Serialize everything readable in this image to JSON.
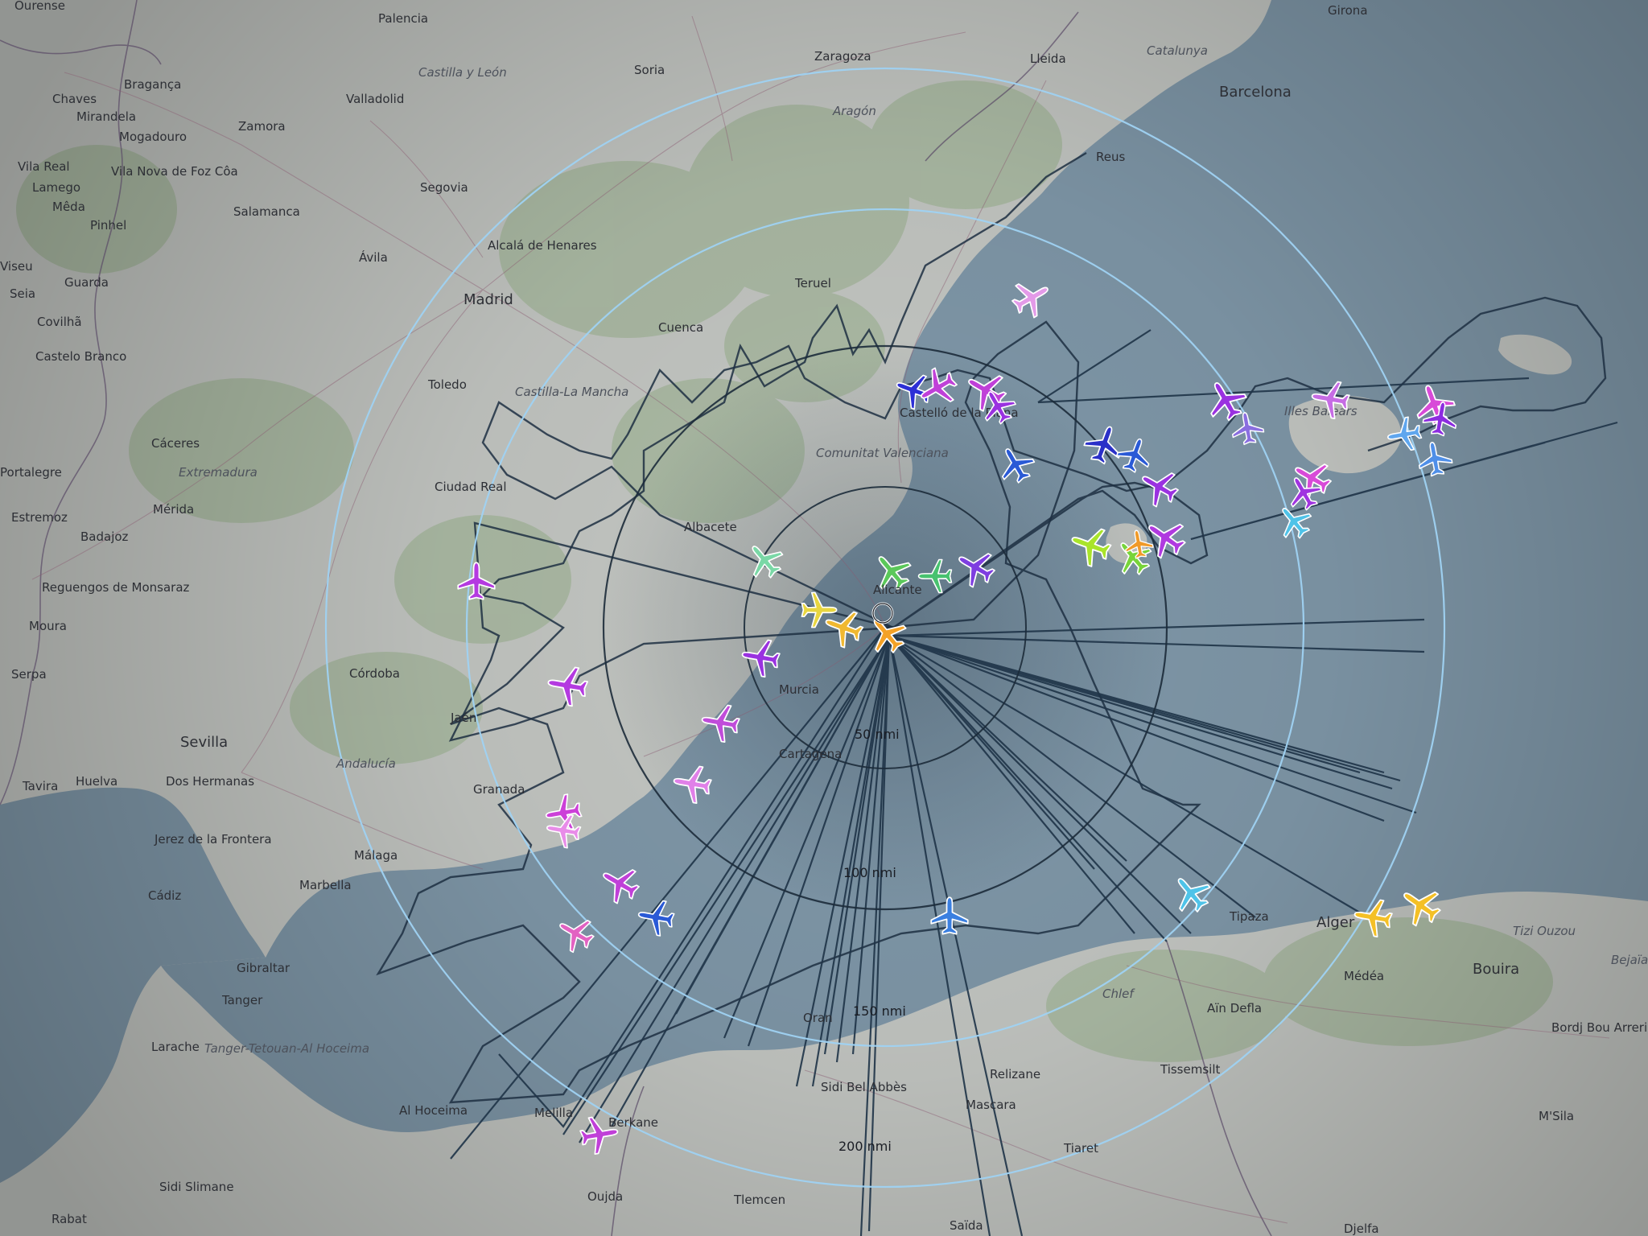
{
  "map": {
    "center_label": "Alicante",
    "range_labels": [
      "50 nmi",
      "100 nmi",
      "150 nmi",
      "200 nmi"
    ],
    "cities": [
      {
        "name": "Ourense"
      },
      {
        "name": "Palencia"
      },
      {
        "name": "Zaragoza"
      },
      {
        "name": "Lleida"
      },
      {
        "name": "Girona"
      },
      {
        "name": "Catalunya"
      },
      {
        "name": "Barcelona"
      },
      {
        "name": "Chaves"
      },
      {
        "name": "Bragança"
      },
      {
        "name": "Mirandela"
      },
      {
        "name": "Mogadouro"
      },
      {
        "name": "Vila Real"
      },
      {
        "name": "Lamego"
      },
      {
        "name": "Vila Nova de Foz Côa"
      },
      {
        "name": "Mêda"
      },
      {
        "name": "Pinhel"
      },
      {
        "name": "Viseu"
      },
      {
        "name": "Guarda"
      },
      {
        "name": "Seia"
      },
      {
        "name": "Covilhã"
      },
      {
        "name": "Castelo Branco"
      },
      {
        "name": "Zamora"
      },
      {
        "name": "Salamanca"
      },
      {
        "name": "Valladolid"
      },
      {
        "name": "Castilla y León"
      },
      {
        "name": "Soria"
      },
      {
        "name": "Aragón"
      },
      {
        "name": "Segovia"
      },
      {
        "name": "Ávila"
      },
      {
        "name": "Alcalá de Henares"
      },
      {
        "name": "Madrid"
      },
      {
        "name": "Teruel"
      },
      {
        "name": "Reus"
      },
      {
        "name": "Cuenca"
      },
      {
        "name": "Toledo"
      },
      {
        "name": "Castilla-La Mancha"
      },
      {
        "name": "Cáceres"
      },
      {
        "name": "Extremadura"
      },
      {
        "name": "Portalegre"
      },
      {
        "name": "Ciudad Real"
      },
      {
        "name": "Mérida"
      },
      {
        "name": "Estremoz"
      },
      {
        "name": "Badajoz"
      },
      {
        "name": "Reguengos de Monsaraz"
      },
      {
        "name": "Moura"
      },
      {
        "name": "Serpa"
      },
      {
        "name": "Córdoba"
      },
      {
        "name": "Jaén"
      },
      {
        "name": "Sevilla"
      },
      {
        "name": "Dos Hermanas"
      },
      {
        "name": "Andalucía"
      },
      {
        "name": "Huelva"
      },
      {
        "name": "Tavira"
      },
      {
        "name": "Granada"
      },
      {
        "name": "Jerez de la Frontera"
      },
      {
        "name": "Málaga"
      },
      {
        "name": "Marbella"
      },
      {
        "name": "Cádiz"
      },
      {
        "name": "Gibraltar"
      },
      {
        "name": "Tanger"
      },
      {
        "name": "Tanger-Tetouan-Al Hoceima"
      },
      {
        "name": "Larache"
      },
      {
        "name": "Al Hoceima"
      },
      {
        "name": "Melilla"
      },
      {
        "name": "Berkane"
      },
      {
        "name": "Oujda"
      },
      {
        "name": "Rabat"
      },
      {
        "name": "Sidi Slimane"
      },
      {
        "name": "Albacete"
      },
      {
        "name": "Comunitat Valenciana"
      },
      {
        "name": "Castelló de la Plana"
      },
      {
        "name": "Murcia"
      },
      {
        "name": "Cartagena"
      },
      {
        "name": "Oran"
      },
      {
        "name": "Sidi Bel Abbès"
      },
      {
        "name": "Mascara"
      },
      {
        "name": "Relizane"
      },
      {
        "name": "Chlef"
      },
      {
        "name": "Aïn Defla"
      },
      {
        "name": "Tissemsilt"
      },
      {
        "name": "Tiaret"
      },
      {
        "name": "Tipaza"
      },
      {
        "name": "Alger"
      },
      {
        "name": "Médéa"
      },
      {
        "name": "Bouira"
      },
      {
        "name": "Tizi Ouzou"
      },
      {
        "name": "Bordj Bou Arreridj"
      },
      {
        "name": "M'Sila"
      },
      {
        "name": "Djelfa"
      },
      {
        "name": "Tlemcen"
      },
      {
        "name": "Saïda"
      },
      {
        "name": "Illes Balears"
      },
      {
        "name": "Bejaïa"
      }
    ],
    "aircraft": [
      {
        "color": "#e39ae8"
      },
      {
        "color": "#2c2fd6"
      },
      {
        "color": "#c040d8"
      },
      {
        "color": "#c040d8"
      },
      {
        "color": "#9a32e0"
      },
      {
        "color": "#2a5ad6"
      },
      {
        "color": "#2a30c8"
      },
      {
        "color": "#2a5ad6"
      },
      {
        "color": "#9a32e0"
      },
      {
        "color": "#8a6ee0"
      },
      {
        "color": "#c66ce4"
      },
      {
        "color": "#d84ad8"
      },
      {
        "color": "#8c2ce0"
      },
      {
        "color": "#5fa6ee"
      },
      {
        "color": "#4f8fe8"
      },
      {
        "color": "#d84ad8"
      },
      {
        "color": "#4fc3e8"
      },
      {
        "color": "#a034e0"
      },
      {
        "color": "#9a32e0"
      },
      {
        "color": "#a9e42a"
      },
      {
        "color": "#78d43a"
      },
      {
        "color": "#f09a28"
      },
      {
        "color": "#b03ae0"
      },
      {
        "color": "#7ad8a6"
      },
      {
        "color": "#5bc85a"
      },
      {
        "color": "#48c26f"
      },
      {
        "color": "#7e3ee0"
      },
      {
        "color": "#e8d640"
      },
      {
        "color": "#f0b830"
      },
      {
        "color": "#f4a226"
      },
      {
        "color": "#9a32e0"
      },
      {
        "color": "#b43ae0"
      },
      {
        "color": "#b43ae0"
      },
      {
        "color": "#c04cda"
      },
      {
        "color": "#e080e8"
      },
      {
        "color": "#cc40d8"
      },
      {
        "color": "#2a5ad6"
      },
      {
        "color": "#e88ce8"
      },
      {
        "color": "#c040d8"
      },
      {
        "color": "#e262c2"
      },
      {
        "color": "#3a7fe0"
      },
      {
        "color": "#4fc3e8"
      },
      {
        "color": "#f4c026"
      },
      {
        "color": "#f4c026"
      },
      {
        "color": "#c040d8"
      }
    ]
  }
}
